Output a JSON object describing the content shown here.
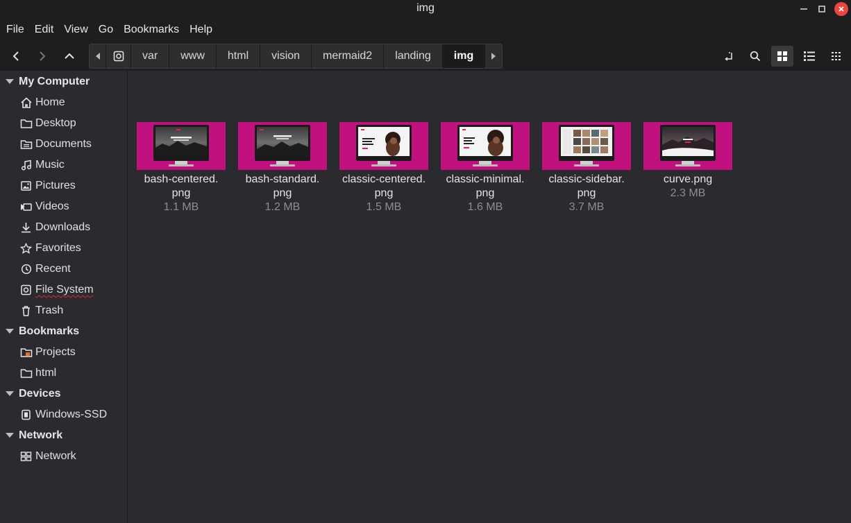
{
  "window": {
    "title": "img"
  },
  "menu": [
    "File",
    "Edit",
    "View",
    "Go",
    "Bookmarks",
    "Help"
  ],
  "breadcrumb": [
    "var",
    "www",
    "html",
    "vision",
    "mermaid2",
    "landing",
    "img"
  ],
  "sidebar": {
    "sections": [
      {
        "title": "My Computer",
        "items": [
          {
            "label": "Home",
            "icon": "home-icon"
          },
          {
            "label": "Desktop",
            "icon": "folder-icon"
          },
          {
            "label": "Documents",
            "icon": "document-icon"
          },
          {
            "label": "Music",
            "icon": "music-icon"
          },
          {
            "label": "Pictures",
            "icon": "picture-icon"
          },
          {
            "label": "Videos",
            "icon": "video-icon"
          },
          {
            "label": "Downloads",
            "icon": "download-icon"
          },
          {
            "label": "Favorites",
            "icon": "star-icon"
          },
          {
            "label": "Recent",
            "icon": "recent-icon"
          },
          {
            "label": "File System",
            "icon": "disk-icon"
          },
          {
            "label": "Trash",
            "icon": "trash-icon"
          }
        ]
      },
      {
        "title": "Bookmarks",
        "items": [
          {
            "label": "Projects",
            "icon": "folder-icon"
          },
          {
            "label": "html",
            "icon": "folder-icon"
          }
        ]
      },
      {
        "title": "Devices",
        "items": [
          {
            "label": "Windows-SSD",
            "icon": "drive-icon"
          }
        ]
      },
      {
        "title": "Network",
        "items": [
          {
            "label": "Network",
            "icon": "network-icon"
          }
        ]
      }
    ]
  },
  "files": [
    {
      "name1": "bash-centered.",
      "name2": "png",
      "size": "1.1 MB",
      "preview": "dark-hero"
    },
    {
      "name1": "bash-standard.",
      "name2": "png",
      "size": "1.2 MB",
      "preview": "dark-hero"
    },
    {
      "name1": "classic-centered.",
      "name2": "png",
      "size": "1.5 MB",
      "preview": "portrait"
    },
    {
      "name1": "classic-minimal.",
      "name2": "png",
      "size": "1.6 MB",
      "preview": "portrait"
    },
    {
      "name1": "classic-sidebar.",
      "name2": "png",
      "size": "3.7 MB",
      "preview": "grid"
    },
    {
      "name1": "curve.png",
      "name2": "",
      "size": "2.3 MB",
      "preview": "landscape"
    }
  ],
  "colors": {
    "thumb_bg": "#c0117e",
    "window_bg": "#2b2b2f",
    "chrome_bg": "#1e1e1e",
    "close": "#e8473d"
  }
}
